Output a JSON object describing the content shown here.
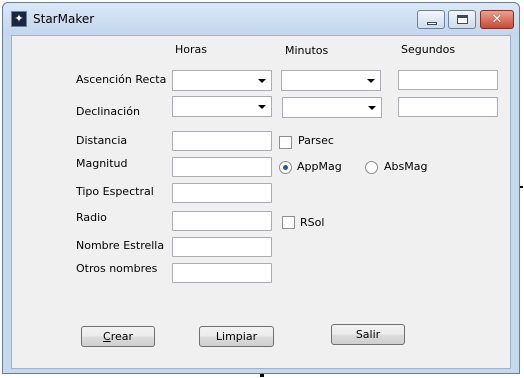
{
  "window": {
    "title": "StarMaker",
    "close_glyph": "✕"
  },
  "columns": {
    "hours": "Horas",
    "minutes": "Minutos",
    "seconds": "Segundos"
  },
  "rows": {
    "ra": "Ascención Recta",
    "dec": "Declinación",
    "distance": "Distancia",
    "magnitude": "Magnitud",
    "spectral_type": "Tipo Espectral",
    "radius": "Radio",
    "star_name": "Nombre Estrella",
    "other_names": "Otros nombres"
  },
  "fields": {
    "ra_hours": "",
    "ra_minutes": "",
    "ra_seconds": "",
    "dec_hours": "",
    "dec_minutes": "",
    "dec_seconds": "",
    "distance": "",
    "magnitude": "",
    "spectral_type": "",
    "radius": "",
    "star_name": "",
    "other_names": ""
  },
  "options": {
    "parsec": {
      "label": "Parsec",
      "checked": false
    },
    "appmag": {
      "label": "AppMag",
      "selected": true
    },
    "absmag": {
      "label": "AbsMag",
      "selected": false
    },
    "rsol": {
      "label": "RSol",
      "checked": false
    }
  },
  "buttons": {
    "crear_mnemonic": "C",
    "crear_rest": "rear",
    "limpiar": "Limpiar",
    "salir": "Salir"
  },
  "icons": {
    "app": "star-icon",
    "minimize": "minimize-icon",
    "maximize": "maximize-icon",
    "close": "close-icon"
  }
}
